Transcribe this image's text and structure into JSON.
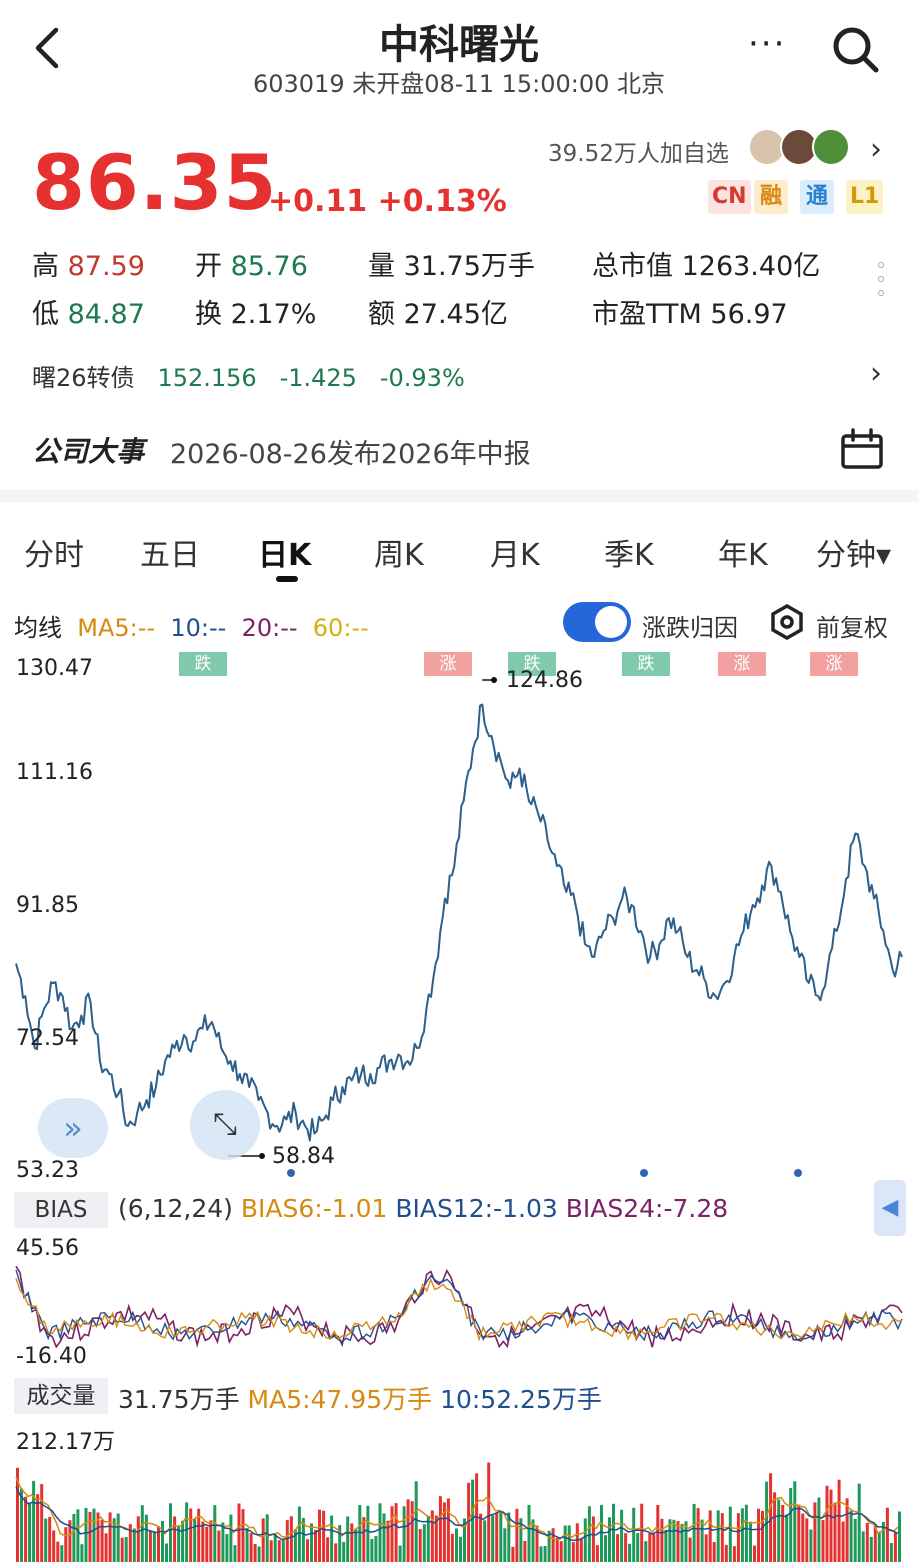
{
  "header": {
    "back_label": "‹",
    "title": "中科曙光",
    "subtitle": "603019 未开盘08-11 15:00:00 北京",
    "more_label": "···",
    "search_icon": "search-icon"
  },
  "quote": {
    "price": "86.35",
    "change": "+0.11 +0.13%",
    "watchers": "39.52万人加自选",
    "badges": [
      "CN",
      "融",
      "通",
      "L1"
    ],
    "stats": {
      "high_label": "高",
      "high": "87.59",
      "open_label": "开",
      "open": "85.76",
      "volume_label": "量",
      "volume": "31.75万手",
      "mktcap_label": "总市值",
      "mktcap": "1263.40亿",
      "low_label": "低",
      "low": "84.87",
      "turnover_label": "换",
      "turnover": "2.17%",
      "amount_label": "额",
      "amount": "27.45亿",
      "pe_label": "市盈TTM",
      "pe": "56.97"
    }
  },
  "bond": {
    "name": "曙26转债",
    "price": "152.156",
    "change": "-1.425",
    "pct": "-0.93%"
  },
  "event": {
    "label": "公司大事",
    "text": "2026-08-26发布2026年中报"
  },
  "tabs": [
    "分时",
    "五日",
    "日K",
    "周K",
    "月K",
    "季K",
    "年K",
    "分钟▾"
  ],
  "active_tab": "日K",
  "ma": {
    "label": "均线",
    "ma5": "MA5:--",
    "ma10": "10:--",
    "ma20": "20:--",
    "ma60": "60:--"
  },
  "toggle_label": "涨跌归因",
  "restore_label": "前复权",
  "tags": [
    {
      "text": "跌",
      "type": "down"
    },
    {
      "text": "涨",
      "type": "up"
    },
    {
      "text": "跌",
      "type": "down"
    },
    {
      "text": "跌",
      "type": "down"
    },
    {
      "text": "涨",
      "type": "up"
    },
    {
      "text": "涨",
      "type": "up"
    }
  ],
  "price_axis": [
    "130.47",
    "111.16",
    "91.85",
    "72.54",
    "53.23"
  ],
  "peak_label": "124.86",
  "low_label": "58.84",
  "bias": {
    "label": "BIAS",
    "params": "(6,12,24)",
    "b6": "BIAS6:-1.01",
    "b12": "BIAS12:-1.03",
    "b24": "BIAS24:-7.28",
    "axis_top": "45.56",
    "axis_bottom": "-16.40"
  },
  "volume": {
    "label": "成交量",
    "value": "31.75万手",
    "ma5": "MA5:47.95万手",
    "ma10": "10:52.25万手",
    "axis_top": "212.17万"
  },
  "colors": {
    "up": "#e5312f",
    "down": "#1d7a4f",
    "line": "#2c5f8a",
    "ma5": "#d58a10",
    "ma10": "#1f4f8f",
    "ma20": "#7b2166",
    "ma60": "#d3b10f"
  },
  "chart_data": {
    "type": "line",
    "title": "",
    "ylim": [
      53.23,
      130.47
    ],
    "y_ticks": [
      130.47,
      111.16,
      91.85,
      72.54,
      53.23
    ],
    "annotations": [
      {
        "text": "124.86",
        "y": 124.86
      },
      {
        "text": "58.84",
        "y": 58.84
      }
    ],
    "series": [
      {
        "values": [
          85,
          80,
          72,
          78,
          82,
          80,
          75,
          77,
          79,
          70,
          68,
          65,
          60,
          62,
          64,
          66,
          70,
          72,
          74,
          73,
          75,
          76,
          72,
          70,
          68,
          66,
          64,
          62,
          60,
          61,
          62,
          60,
          58.84,
          61,
          64,
          66,
          67,
          68,
          68,
          69,
          70,
          71,
          70,
          72,
          78,
          85,
          95,
          100,
          110,
          118,
          124.86,
          120,
          116,
          112,
          115,
          110,
          108,
          104,
          100,
          96,
          94,
          88,
          86,
          90,
          92,
          95,
          94,
          90,
          86,
          88,
          92,
          90,
          86,
          84,
          82,
          80,
          82,
          86,
          90,
          94,
          97,
          100,
          96,
          90,
          86,
          82,
          80,
          84,
          90,
          98,
          105,
          100,
          95,
          90,
          84,
          86
        ]
      }
    ]
  }
}
